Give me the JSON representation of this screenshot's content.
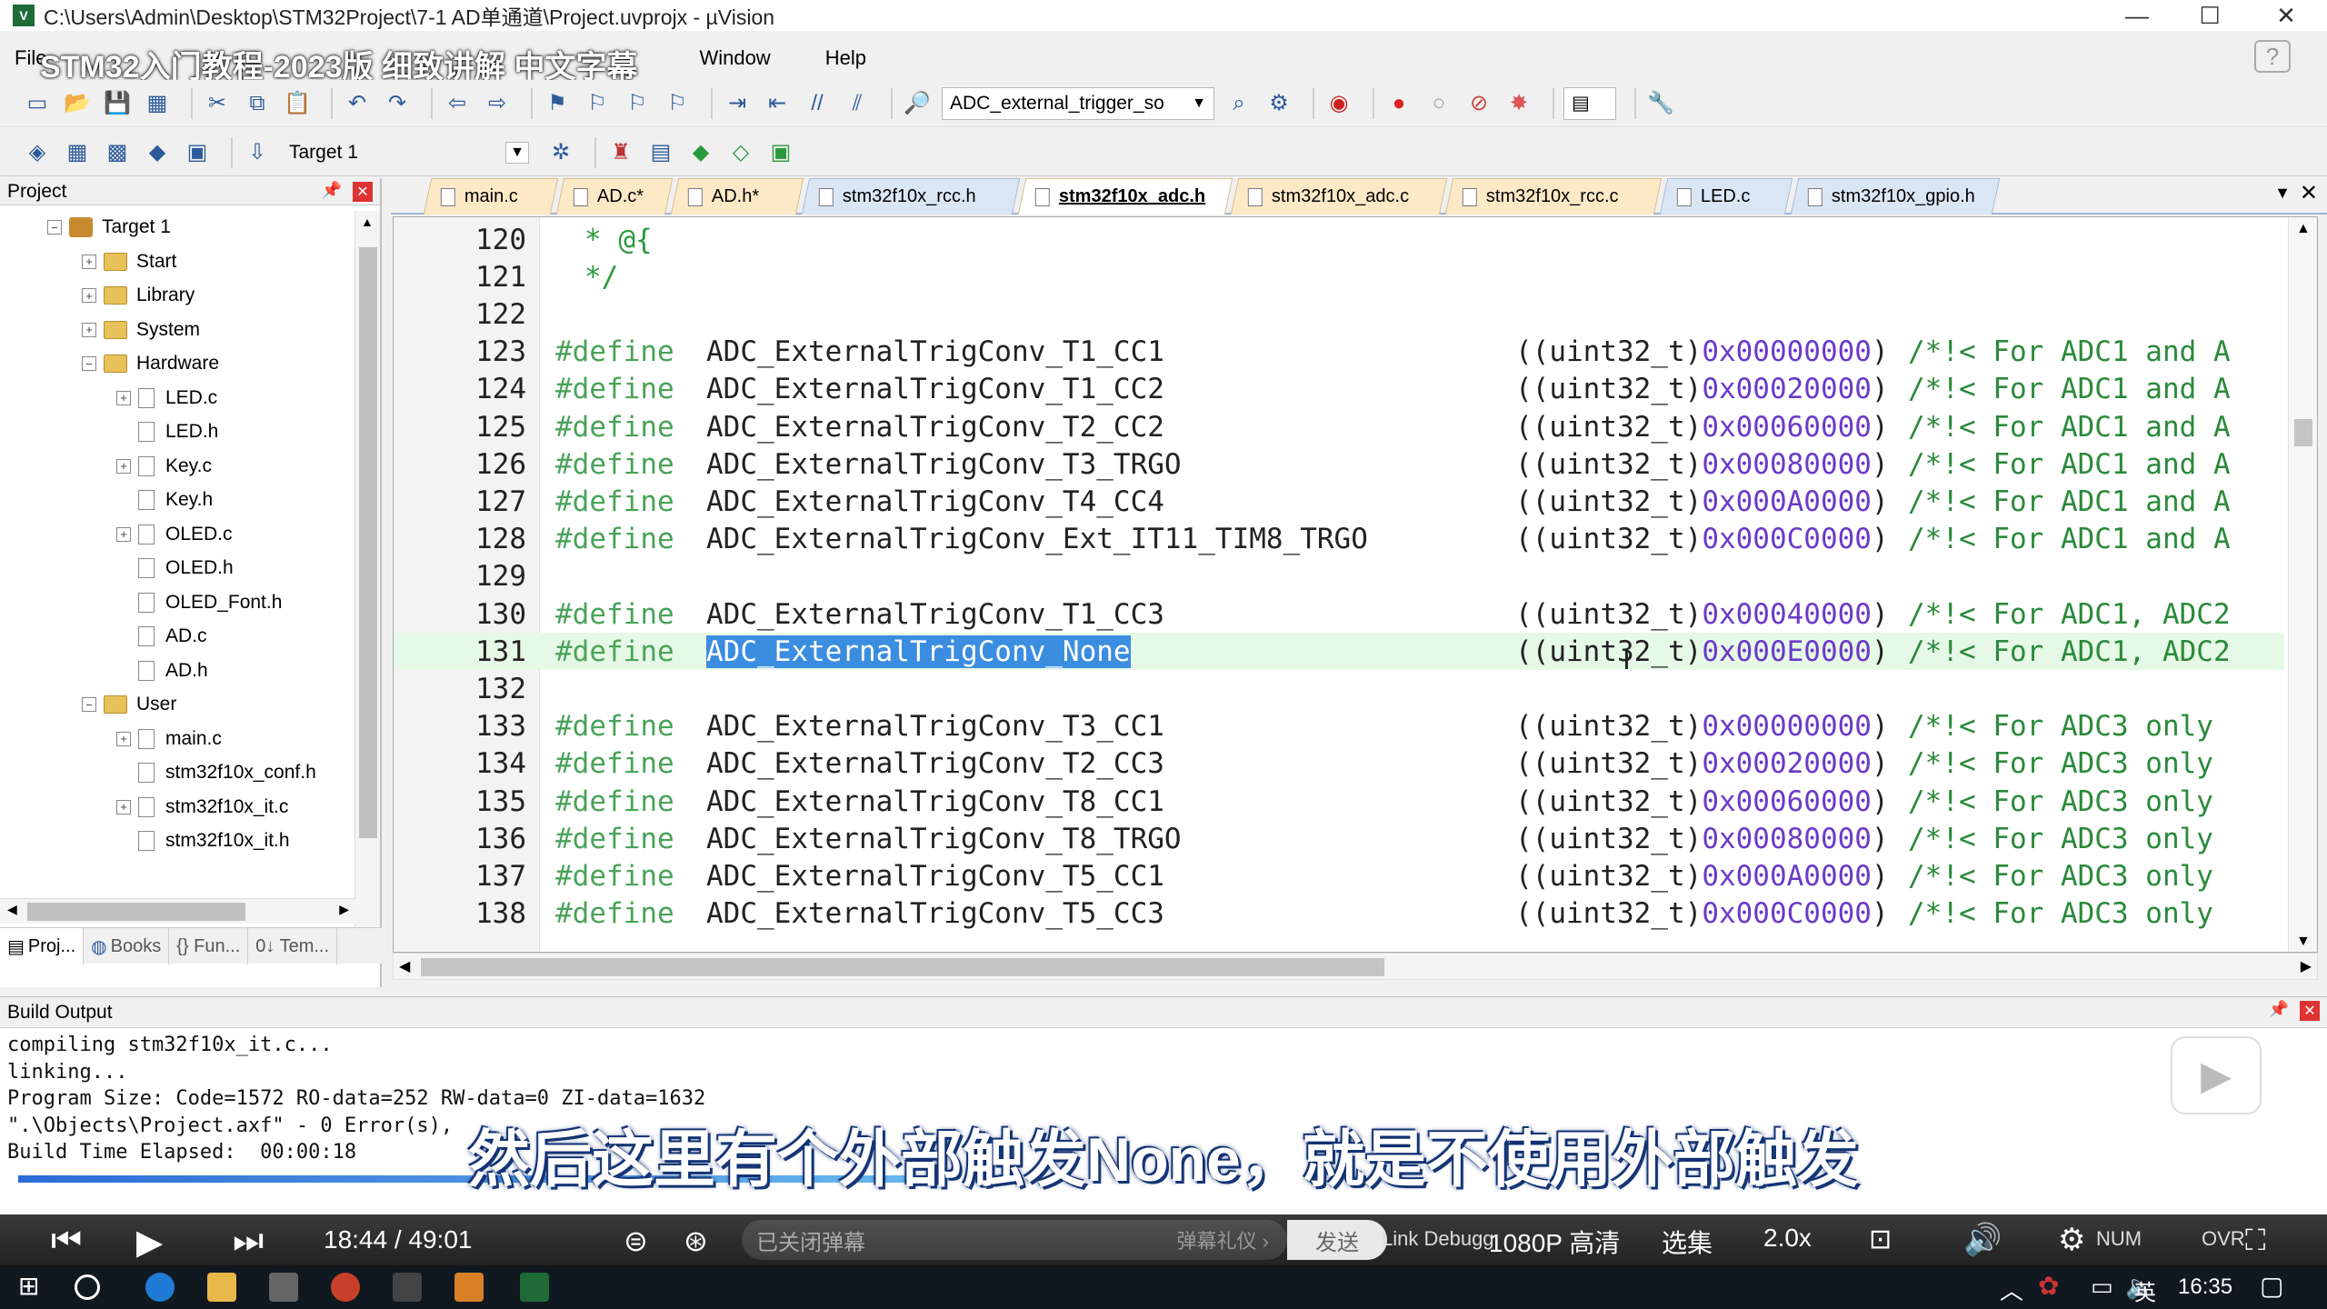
{
  "window": {
    "title": "C:\\Users\\Admin\\Desktop\\STM32Project\\7-1 AD单通道\\Project.uvprojx - µVision",
    "minimize": "—",
    "maximize": "☐",
    "close": "✕"
  },
  "overlay_title": "STM32入门教程-2023版 细致讲解 中文字幕",
  "menu": [
    "File",
    "Window",
    "Help"
  ],
  "toolbar": {
    "function_combo": "ADC_external_trigger_so",
    "target_combo": "Target 1"
  },
  "project": {
    "header": "Project",
    "tree": [
      {
        "label": "Target 1",
        "kind": "target",
        "level": 0,
        "exp": "−"
      },
      {
        "label": "Start",
        "kind": "folder",
        "level": 1,
        "exp": "+"
      },
      {
        "label": "Library",
        "kind": "folder",
        "level": 1,
        "exp": "+"
      },
      {
        "label": "System",
        "kind": "folder",
        "level": 1,
        "exp": "+"
      },
      {
        "label": "Hardware",
        "kind": "folder",
        "level": 1,
        "exp": "−"
      },
      {
        "label": "LED.c",
        "kind": "file",
        "level": 2,
        "exp": "+"
      },
      {
        "label": "LED.h",
        "kind": "file",
        "level": 2,
        "exp": ""
      },
      {
        "label": "Key.c",
        "kind": "file",
        "level": 2,
        "exp": "+"
      },
      {
        "label": "Key.h",
        "kind": "file",
        "level": 2,
        "exp": ""
      },
      {
        "label": "OLED.c",
        "kind": "file",
        "level": 2,
        "exp": "+"
      },
      {
        "label": "OLED.h",
        "kind": "file",
        "level": 2,
        "exp": ""
      },
      {
        "label": "OLED_Font.h",
        "kind": "file",
        "level": 2,
        "exp": ""
      },
      {
        "label": "AD.c",
        "kind": "file",
        "level": 2,
        "exp": ""
      },
      {
        "label": "AD.h",
        "kind": "file",
        "level": 2,
        "exp": ""
      },
      {
        "label": "User",
        "kind": "folder",
        "level": 1,
        "exp": "−"
      },
      {
        "label": "main.c",
        "kind": "file",
        "level": 2,
        "exp": "+"
      },
      {
        "label": "stm32f10x_conf.h",
        "kind": "file",
        "level": 2,
        "exp": ""
      },
      {
        "label": "stm32f10x_it.c",
        "kind": "file",
        "level": 2,
        "exp": "+"
      },
      {
        "label": "stm32f10x_it.h",
        "kind": "file",
        "level": 2,
        "exp": ""
      }
    ],
    "tabs": [
      "Proj...",
      "Books",
      "{} Fun...",
      "0↓ Tem..."
    ]
  },
  "file_tabs": [
    {
      "label": "main.c",
      "style": "orange"
    },
    {
      "label": "AD.c*",
      "style": "orange"
    },
    {
      "label": "AD.h*",
      "style": "orange"
    },
    {
      "label": "stm32f10x_rcc.h",
      "style": "blue"
    },
    {
      "label": "stm32f10x_adc.h",
      "style": "active"
    },
    {
      "label": "stm32f10x_adc.c",
      "style": "orange"
    },
    {
      "label": "stm32f10x_rcc.c",
      "style": "orange"
    },
    {
      "label": "LED.c",
      "style": "blue"
    },
    {
      "label": "stm32f10x_gpio.h",
      "style": "blue"
    }
  ],
  "code": [
    {
      "n": "120",
      "type": "comment",
      "text": "* @{"
    },
    {
      "n": "121",
      "type": "comment",
      "text": "*/"
    },
    {
      "n": "122",
      "type": "blank"
    },
    {
      "n": "123",
      "type": "define",
      "macro": "ADC_ExternalTrigConv_T1_CC1",
      "hex": "0x00000000",
      "tail": "/*!< For ADC1 and A"
    },
    {
      "n": "124",
      "type": "define",
      "macro": "ADC_ExternalTrigConv_T1_CC2",
      "hex": "0x00020000",
      "tail": "/*!< For ADC1 and A"
    },
    {
      "n": "125",
      "type": "define",
      "macro": "ADC_ExternalTrigConv_T2_CC2",
      "hex": "0x00060000",
      "tail": "/*!< For ADC1 and A"
    },
    {
      "n": "126",
      "type": "define",
      "macro": "ADC_ExternalTrigConv_T3_TRGO",
      "hex": "0x00080000",
      "tail": "/*!< For ADC1 and A"
    },
    {
      "n": "127",
      "type": "define",
      "macro": "ADC_ExternalTrigConv_T4_CC4",
      "hex": "0x000A0000",
      "tail": "/*!< For ADC1 and A"
    },
    {
      "n": "128",
      "type": "define",
      "macro": "ADC_ExternalTrigConv_Ext_IT11_TIM8_TRGO",
      "hex": "0x000C0000",
      "tail": "/*!< For ADC1 and A"
    },
    {
      "n": "129",
      "type": "blank"
    },
    {
      "n": "130",
      "type": "define",
      "macro": "ADC_ExternalTrigConv_T1_CC3",
      "hex": "0x00040000",
      "tail": "/*!< For ADC1, ADC2"
    },
    {
      "n": "131",
      "type": "define",
      "macro": "ADC_ExternalTrigConv_None",
      "hex": "0x000E0000",
      "tail": "/*!< For ADC1, ADC2",
      "highlight": true
    },
    {
      "n": "132",
      "type": "blank"
    },
    {
      "n": "133",
      "type": "define",
      "macro": "ADC_ExternalTrigConv_T3_CC1",
      "hex": "0x00000000",
      "tail": "/*!< For ADC3 only"
    },
    {
      "n": "134",
      "type": "define",
      "macro": "ADC_ExternalTrigConv_T2_CC3",
      "hex": "0x00020000",
      "tail": "/*!< For ADC3 only"
    },
    {
      "n": "135",
      "type": "define",
      "macro": "ADC_ExternalTrigConv_T8_CC1",
      "hex": "0x00060000",
      "tail": "/*!< For ADC3 only"
    },
    {
      "n": "136",
      "type": "define",
      "macro": "ADC_ExternalTrigConv_T8_TRGO",
      "hex": "0x00080000",
      "tail": "/*!< For ADC3 only"
    },
    {
      "n": "137",
      "type": "define",
      "macro": "ADC_ExternalTrigConv_T5_CC1",
      "hex": "0x000A0000",
      "tail": "/*!< For ADC3 only"
    },
    {
      "n": "138",
      "type": "define",
      "macro": "ADC_ExternalTrigConv_T5_CC3",
      "hex": "0x000C0000",
      "tail": "/*!< For ADC3 only"
    }
  ],
  "code_strings": {
    "define_kw": "#define",
    "cast": "((uint32_t)",
    "close": ")"
  },
  "build": {
    "header": "Build Output",
    "lines": [
      "compiling stm32f10x_it.c...",
      "linking...",
      "Program Size: Code=1572 RO-data=252 RW-data=0 ZI-data=1632",
      "\".\\Objects\\Project.axf\" - 0 Error(s),",
      "Build Time Elapsed:  00:00:18"
    ]
  },
  "subtitle": "然后这里有个外部触发None，就是不使用外部触发",
  "player": {
    "time": "18:44 / 49:01",
    "danmaku_placeholder": "已关闭弹幕",
    "gift": "弹幕礼仪 ›",
    "send": "发送",
    "status_left": "Link Debugg",
    "quality": "1080P 高清",
    "episodes": "选集",
    "speed": "2.0x",
    "status_right": "NUM",
    "ovr": "OVR"
  },
  "taskbar": {
    "lang": "英",
    "clock": "16:35"
  }
}
